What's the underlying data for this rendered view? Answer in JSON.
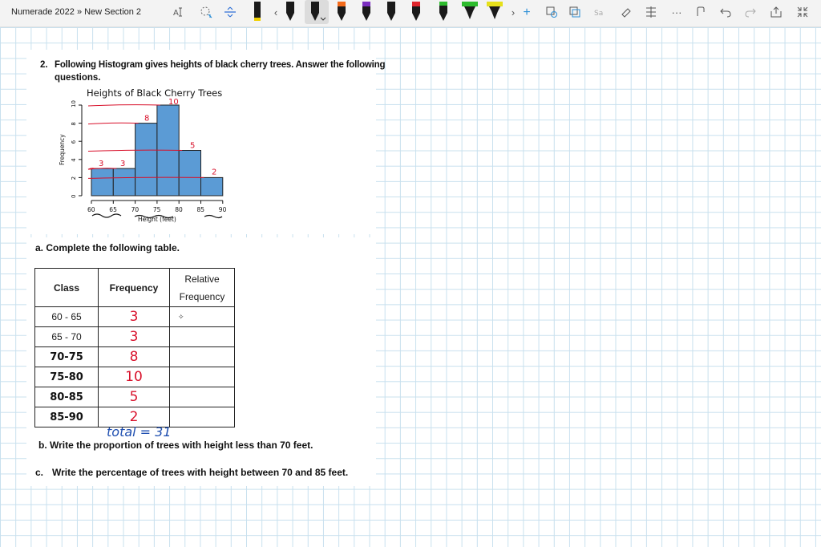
{
  "toolbar": {
    "breadcrumb": "Numerade 2022 » New Section 2",
    "icons": [
      "text-format-icon",
      "lasso-select-icon",
      "insert-space-icon",
      "pen-black",
      "pen-black",
      "pen-black",
      "pen-orange",
      "pen-purple",
      "pen-black",
      "pen-red",
      "pen-black",
      "pen-green",
      "pen-green",
      "pen-yellow",
      "add-icon",
      "shapes-icon",
      "copy-icon",
      "ink-to-text-icon",
      "eraser-icon",
      "ruler-icon",
      "more-icon",
      "replay-icon",
      "undo-icon",
      "redo-icon",
      "share-icon",
      "collapse-icon"
    ],
    "colors": {
      "black": "#1a1a1a",
      "orange": "#f26a1b",
      "purple": "#7b2fbf",
      "red": "#e0262d",
      "green": "#2dbb2d",
      "yellow": "#e6e01a",
      "highlight": "#f0d000"
    }
  },
  "document": {
    "question_number": "2.",
    "question_text_line1": "Following Histogram gives heights of black cherry trees.  Answer the following",
    "question_text_line2": "questions.",
    "part_a": "a.  Complete the following table.",
    "part_b": "b. Write the proportion of trees with height less than 70 feet.",
    "part_c_label": "c.",
    "part_c_text": "Write the percentage of trees with height between 70 and 85 feet."
  },
  "chart_data": {
    "type": "bar",
    "title": "Heights of Black Cherry Trees",
    "xlabel": "Height (feet)",
    "ylabel": "Frequency",
    "bin_edges": [
      60,
      65,
      70,
      75,
      80,
      85,
      90
    ],
    "values": [
      3,
      3,
      8,
      10,
      5,
      2
    ],
    "x_ticks": [
      "60",
      "65",
      "70",
      "75",
      "80",
      "85",
      "90"
    ],
    "y_ticks": [
      "0",
      "2",
      "4",
      "6",
      "8",
      "10"
    ],
    "ylim": [
      0,
      10
    ],
    "bar_color": "#5b9bd5",
    "annotations": [
      "3",
      "3",
      "8",
      "10",
      "5",
      "2"
    ],
    "annotation_color": "#d8102a"
  },
  "table": {
    "headers": {
      "class": "Class",
      "frequency": "Frequency",
      "relative_line1": "Relative",
      "relative_line2": "Frequency"
    },
    "rows": [
      {
        "class": "60 - 65",
        "frequency": "3",
        "relative": "✧"
      },
      {
        "class": "65 - 70",
        "frequency": "3",
        "relative": ""
      },
      {
        "class": "70-75",
        "frequency": "8",
        "relative": ""
      },
      {
        "class": "75-80",
        "frequency": "10",
        "relative": ""
      },
      {
        "class": "80-85",
        "frequency": "5",
        "relative": ""
      },
      {
        "class": "85-90",
        "frequency": "2",
        "relative": ""
      }
    ],
    "total_note": "total = 31"
  }
}
